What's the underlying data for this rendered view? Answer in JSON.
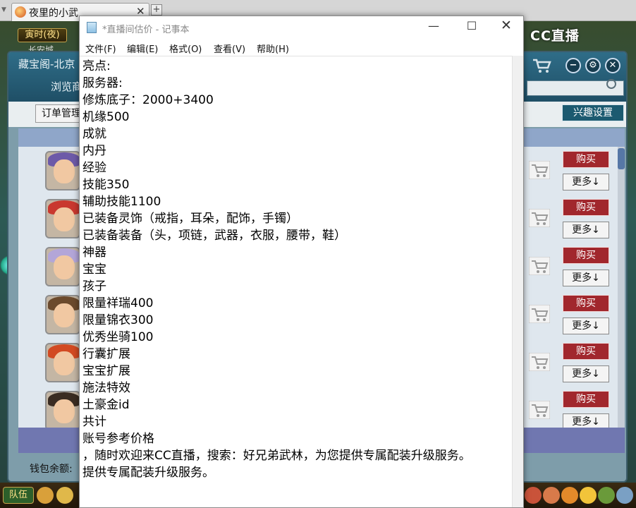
{
  "browser": {
    "tab_title": "夜里的小武",
    "tab_close": "✕",
    "tab_new": "+",
    "tabs_left": "▼"
  },
  "game": {
    "time_badge": "寅时(夜)",
    "location": "长安城",
    "cbg": {
      "title": "藏宝阁-北京",
      "browse": "浏览商",
      "order_mgmt": "订单管理",
      "interest": "兴趣设置",
      "buy_label": "购买",
      "more_label": "更多↓",
      "wallet": "钱包余额:",
      "icons": {
        "minimize": "−",
        "settings": "⚙",
        "close": "✕"
      }
    },
    "logo": "CC直播",
    "team_btn": "队伍"
  },
  "notepad": {
    "title": "*直播间估价 - 记事本",
    "controls": {
      "minimize": "—",
      "maximize": "☐",
      "close": "✕"
    },
    "menus": [
      "文件(F)",
      "编辑(E)",
      "格式(O)",
      "查看(V)",
      "帮助(H)"
    ],
    "lines": [
      "亮点:",
      "服务器:",
      "修炼底子：2000+3400",
      "机缘500",
      "成就",
      "内丹",
      "经验",
      "技能350",
      "辅助技能1100",
      "已装备灵饰（戒指，耳朵，配饰，手镯）",
      "已装备装备（头，项链，武器，衣服，腰带，鞋）",
      "神器",
      "宝宝",
      "孩子",
      "限量祥瑞400",
      "限量锦衣300",
      "优秀坐骑100",
      "行囊扩展",
      "宝宝扩展",
      "施法特效",
      "土豪金id",
      "共计",
      "账号参考价格",
      "，随时欢迎来CC直播，搜索：好兄弟武林，为您提供专属配装升级服务。",
      "提供专属配装升级服务。"
    ]
  }
}
